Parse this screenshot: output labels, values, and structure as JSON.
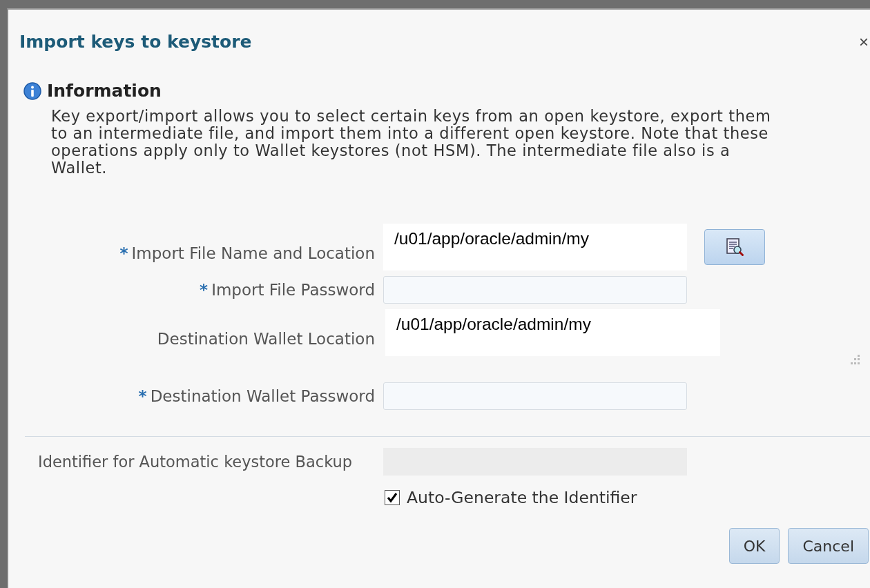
{
  "dialog": {
    "title": "Import keys to keystore",
    "close": "×"
  },
  "info": {
    "heading": "Information",
    "text": "Key export/import allows you to select certain keys from an open keystore, export them to an intermediate file, and import them into a different open keystore. Note that these operations apply only to Wallet keystores (not HSM). The intermediate file also is a Wallet."
  },
  "fields": [
    {
      "kind": "text",
      "label": "Import File Name and Location",
      "required": true,
      "value": "/u01/app/oracle/admin/my",
      "browse": true
    },
    {
      "kind": "password",
      "label": "Import File Password",
      "required": true,
      "browse": false
    },
    {
      "kind": "text",
      "label": "Destination Wallet Location",
      "required": false,
      "value": "/u01/app/oracle/admin/my",
      "browse": false
    },
    {
      "kind": "password",
      "label": "Destination Wallet Password",
      "required": true,
      "browse": false
    }
  ],
  "required_mark": "*",
  "identifier": {
    "label": "Identifier for Automatic keystore Backup",
    "disabled": true
  },
  "auto_generate": {
    "label": "Auto-Generate the Identifier",
    "checked": true
  },
  "buttons": [
    "OK",
    "Cancel"
  ]
}
